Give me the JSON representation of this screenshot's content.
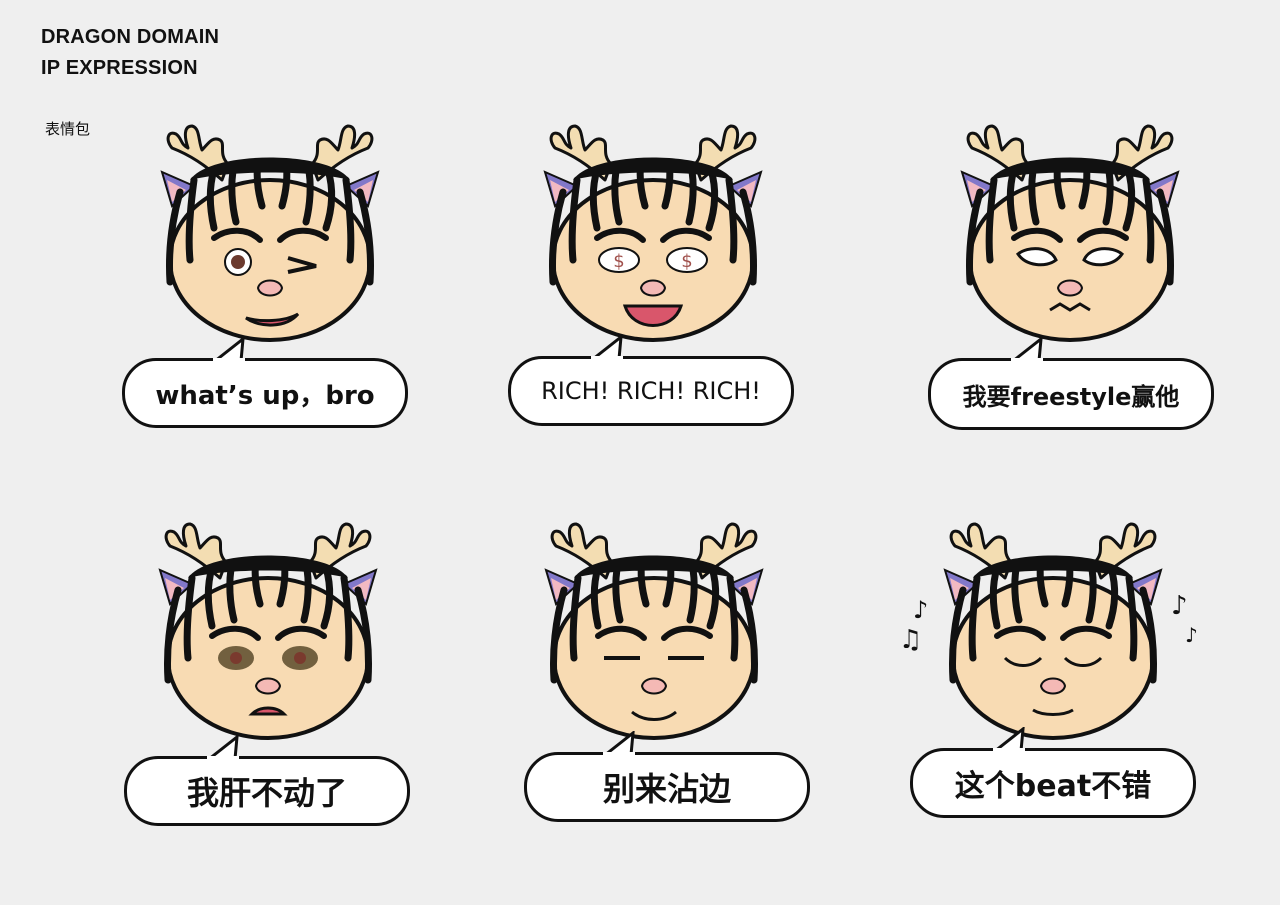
{
  "header": {
    "title_line1": "DRAGON DOMAIN",
    "title_line2": "IP EXPRESSION",
    "subtitle": "表情包"
  },
  "colors": {
    "background": "#efefef",
    "skin": "#f8dbb3",
    "outline": "#111111",
    "horn": "#f3ddb2",
    "ear_outer": "#8278c9",
    "ear_inner": "#f2b9c2",
    "mouth": "#d9566b",
    "nose": "#f4b9b5",
    "bubble_fill": "#ffffff"
  },
  "stickers": [
    {
      "caption": "what’s up，bro",
      "expression": "wink-smirk"
    },
    {
      "caption": "RICH!  RICH!  RICH!",
      "expression": "money-eyes"
    },
    {
      "caption": "我要freestyle赢他",
      "expression": "angry-huff"
    },
    {
      "caption": "我肝不动了",
      "expression": "exhausted"
    },
    {
      "caption": "别来沾边",
      "expression": "disdain"
    },
    {
      "caption": "这个beat不错",
      "expression": "enjoying-music"
    }
  ]
}
